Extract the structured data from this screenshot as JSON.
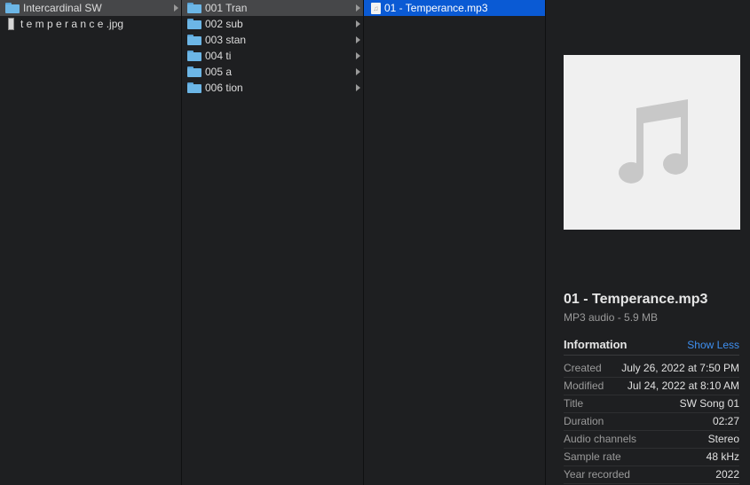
{
  "column1": {
    "items": [
      {
        "label": "Intercardinal SW",
        "type": "folder",
        "selected": true,
        "chevron": true
      },
      {
        "label": "t e m p e r a n c e .jpg",
        "type": "image",
        "selected": false,
        "chevron": false
      }
    ]
  },
  "column2": {
    "items": [
      {
        "label": "001 Tran",
        "selected": true
      },
      {
        "label": "002 sub",
        "selected": false
      },
      {
        "label": "003 stan",
        "selected": false
      },
      {
        "label": "004 ti",
        "selected": false
      },
      {
        "label": "005 a",
        "selected": false
      },
      {
        "label": "006 tion",
        "selected": false
      }
    ]
  },
  "column3": {
    "items": [
      {
        "label": "01 - Temperance.mp3",
        "selected": true
      }
    ]
  },
  "preview": {
    "artwork_icon": "music-note-icon",
    "file_name": "01 - Temperance.mp3",
    "file_kind": "MP3 audio - 5.9 MB",
    "info_heading": "Information",
    "show_less": "Show Less",
    "info": [
      {
        "key": "Created",
        "value": "July 26, 2022 at 7:50 PM"
      },
      {
        "key": "Modified",
        "value": "Jul 24, 2022 at 8:10 AM"
      },
      {
        "key": "Title",
        "value": "SW Song 01"
      },
      {
        "key": "Duration",
        "value": "02:27"
      },
      {
        "key": "Audio channels",
        "value": "Stereo"
      },
      {
        "key": "Sample rate",
        "value": "48 kHz"
      },
      {
        "key": "Year recorded",
        "value": "2022"
      }
    ]
  },
  "colors": {
    "background": "#1e1f21",
    "selection_active": "#0a5ad4",
    "selection_inactive": "#464749",
    "folder": "#6cb6e6",
    "link": "#3e8ff0"
  }
}
